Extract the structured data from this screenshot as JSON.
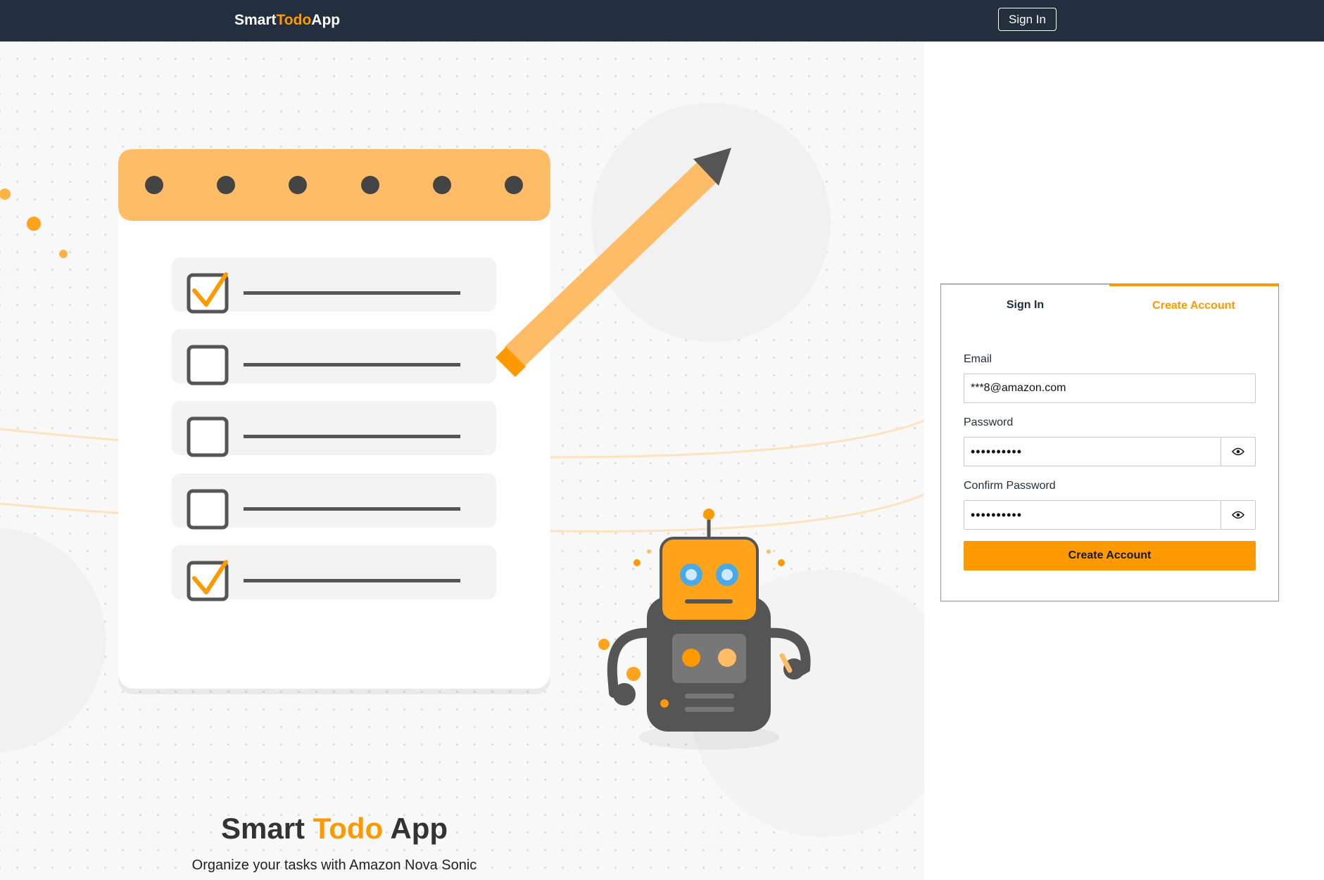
{
  "header": {
    "brand_part1": "Smart",
    "brand_part2": "Todo",
    "brand_part3": "App",
    "sign_in_button": "Sign In"
  },
  "hero": {
    "title_part1": "Smart",
    "title_part2": "Todo",
    "title_part3": "App",
    "subtitle": "Organize your tasks with Amazon Nova Sonic",
    "checklist": [
      {
        "checked": true
      },
      {
        "checked": false
      },
      {
        "checked": false
      },
      {
        "checked": false
      },
      {
        "checked": true
      }
    ]
  },
  "auth": {
    "tabs": [
      {
        "label": "Sign In",
        "active": false
      },
      {
        "label": "Create Account",
        "active": true
      }
    ],
    "email_label": "Email",
    "email_value": "***8@amazon.com",
    "password_label": "Password",
    "password_value": "••••••••••",
    "confirm_password_label": "Confirm Password",
    "confirm_password_value": "••••••••••",
    "submit_label": "Create Account"
  },
  "icons": {
    "show_password": "eye-icon",
    "checkbox_checked": "check-icon",
    "checkbox_empty": "checkbox-icon",
    "pencil": "pencil-icon",
    "robot": "robot-icon"
  },
  "colors": {
    "header_bg": "#232f3e",
    "accent": "#ff9900",
    "accent_light": "#ffbc66",
    "hero_bg": "#f8f8f8",
    "robot_body": "#555555"
  }
}
